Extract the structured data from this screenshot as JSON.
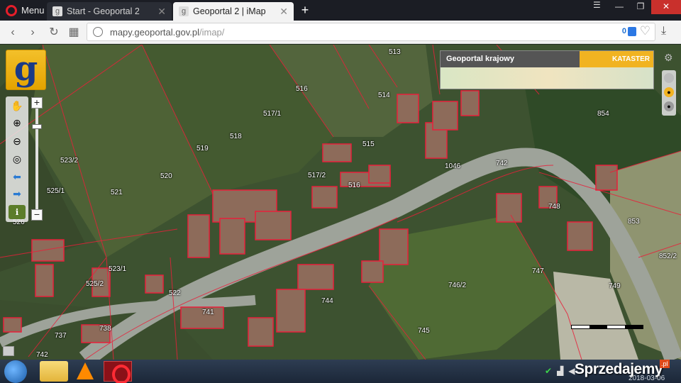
{
  "browser": {
    "menu_label": "Menu",
    "tabs": [
      {
        "title": "Start - Geoportal 2",
        "active": false
      },
      {
        "title": "Geoportal 2 | iMap",
        "active": true
      }
    ],
    "new_tab": "+",
    "window_controls": [
      "—",
      "❐",
      "✕"
    ],
    "url": {
      "host": "mapy.geoportal.gov.pl",
      "path": "/imap/"
    },
    "blocked_count": "0",
    "accent": "#e61e2a"
  },
  "map": {
    "logo_letter": "g",
    "overview": {
      "title": "Geoportal krajowy",
      "tab_label": "KATASTER"
    },
    "parcels": [
      "513",
      "516",
      "514",
      "517/1",
      "518",
      "519",
      "515",
      "854",
      "523/2",
      "520",
      "517/2",
      "1046",
      "742",
      "525/1",
      "521",
      "516",
      "748",
      "526",
      "853",
      "852/2",
      "523/1",
      "525/2",
      "747",
      "746/2",
      "749",
      "522",
      "741",
      "744",
      "737",
      "738",
      "745",
      "742"
    ],
    "colors": {
      "parcel_line": "#e8203a",
      "road": "#9ea39a"
    }
  },
  "taskbar": {
    "watermark": "Sprzedajemy",
    "watermark_badge": ".pl",
    "date": "2018-03-06"
  }
}
